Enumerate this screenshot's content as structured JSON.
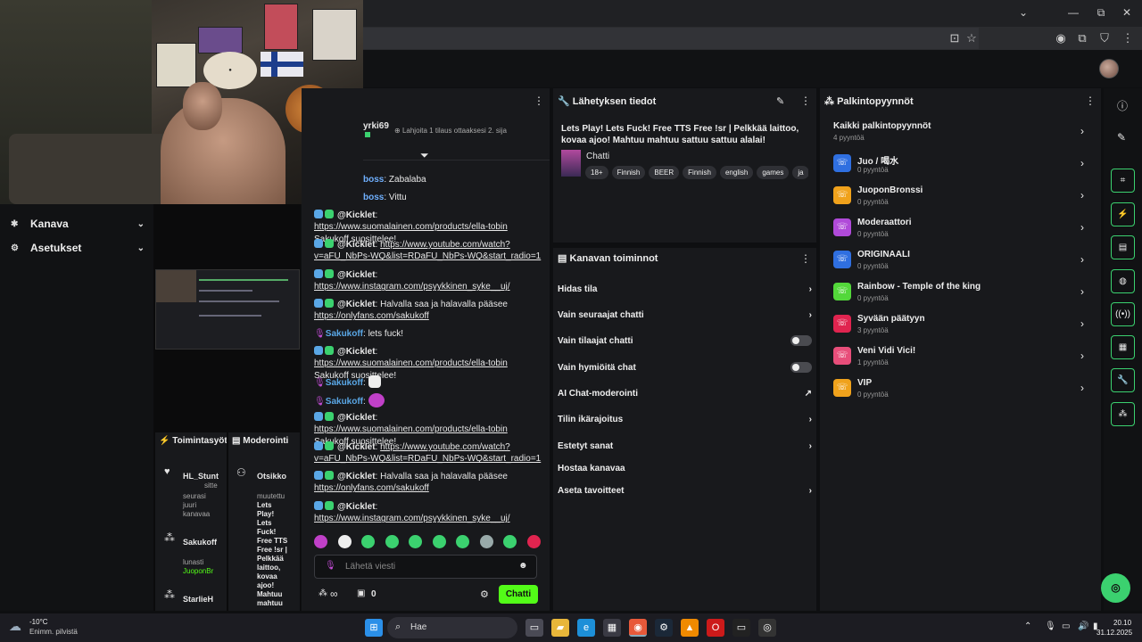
{
  "browser": {
    "window_controls": [
      "⌄",
      "—",
      "⧉",
      "✕"
    ]
  },
  "left_nav": {
    "items": [
      {
        "label": "Kanava"
      },
      {
        "label": "Asetukset"
      }
    ]
  },
  "activity_panel": {
    "title": "Toimintasyöt",
    "entries": [
      {
        "user": "HL_Stunt",
        "line1": "sitte",
        "line2": "seurasi",
        "line3": "juuri",
        "line4": "kanavaa"
      },
      {
        "user": "Sakukoff",
        "line1": "lunasti",
        "reward": "JuoponBr"
      },
      {
        "user": "StarlieH"
      }
    ]
  },
  "mod_panel": {
    "title": "Moderointi",
    "entry_title": "Otsikko",
    "entry_text": [
      "muutettu",
      "Lets",
      "Play!",
      "Lets",
      "Fuck!",
      "Free TTS",
      "Free !sr |",
      "Pelkkää",
      "laittoo,",
      "kovaa",
      "ajoo!",
      "Mahtuu",
      "mahtuu"
    ]
  },
  "chat": {
    "top_user": "yrki69",
    "sub_prompt": "Lahjoita 1 tilaus ottaaksesi 2. sija",
    "messages": [
      {
        "user": "boss",
        "text": "Zabalaba",
        "kind": "plain"
      },
      {
        "user": "boss",
        "text": "Vittu",
        "kind": "plain"
      },
      {
        "user": "@Kicklet",
        "link": "https://www.suomalainen.com/products/ella-tobin",
        "text": " Sakukoff suosittelee!",
        "kind": "bot"
      },
      {
        "user": "@Kicklet",
        "link": "https://www.youtube.com/watch?v=aFU_NbPs-WQ&list=RDaFU_NbPs-WQ&start_radio=1",
        "text": "",
        "kind": "bot"
      },
      {
        "user": "@Kicklet",
        "link": "https://www.instagram.com/psyykkinen_syke__uj/",
        "text": "",
        "kind": "bot"
      },
      {
        "user": "@Kicklet",
        "text": "Halvalla saa ja halavalla pääsee ",
        "link": "https://onlyfans.com/sakukoff",
        "kind": "bot-text"
      },
      {
        "user": "Sakukoff",
        "text": "lets fuck!",
        "kind": "owner"
      },
      {
        "user": "@Kicklet",
        "link": "https://www.suomalainen.com/products/ella-tobin",
        "text": " Sakukoff suosittelee!",
        "kind": "bot"
      },
      {
        "user": "Sakukoff",
        "text": "",
        "kind": "owner-emote"
      },
      {
        "user": "Sakukoff",
        "text": "",
        "kind": "owner-emote"
      },
      {
        "user": "@Kicklet",
        "link": "https://www.suomalainen.com/products/ella-tobin",
        "text": " Sakukoff suosittelee!",
        "kind": "bot"
      },
      {
        "user": "@Kicklet",
        "link": "https://www.youtube.com/watch?v=aFU_NbPs-WQ&list=RDaFU_NbPs-WQ&start_radio=1",
        "text": "",
        "kind": "bot"
      },
      {
        "user": "@Kicklet",
        "text": "Halvalla saa ja halavalla pääsee ",
        "link": "https://onlyfans.com/sakukoff",
        "kind": "bot-text"
      },
      {
        "user": "@Kicklet",
        "link": "https://www.instagram.com/psyykkinen_syke__uj/",
        "text": "",
        "kind": "bot"
      }
    ],
    "input_placeholder": "Lähetä viesti",
    "infinity": "∞",
    "gift_count": "0",
    "send_label": "Chatti"
  },
  "stream_info": {
    "title": "Lähetyksen tiedot",
    "stream_title": "Lets Play! Lets Fuck! Free TTS Free !sr | Pelkkää laittoo, kovaa ajoo! Mahtuu mahtuu sattuu sattuu alalai!",
    "category": "Chatti",
    "tags": [
      "18+",
      "Finnish",
      "BEER",
      "Finnish",
      "english",
      "games",
      "ja"
    ]
  },
  "channel_actions": {
    "title": "Kanavan toiminnot",
    "rows": [
      {
        "label": "Hidas tila",
        "control": "chevron"
      },
      {
        "label": "Vain seuraajat chatti",
        "control": "chevron"
      },
      {
        "label": "Vain tilaajat chatti",
        "control": "toggle"
      },
      {
        "label": "Vain hymiöitä chat",
        "control": "toggle"
      },
      {
        "label": "AI Chat-moderointi",
        "control": "external"
      },
      {
        "label": "Tilin ikärajoitus",
        "control": "chevron"
      },
      {
        "label": "Estetyt sanat",
        "control": "chevron"
      },
      {
        "label": "Hostaa kanavaa",
        "control": "none"
      },
      {
        "label": "Aseta tavoitteet",
        "control": "chevron"
      }
    ]
  },
  "rewards": {
    "title": "Palkintopyynnöt",
    "all_label": "Kaikki palkintopyynnöt",
    "all_count": "4 pyyntöä",
    "items": [
      {
        "name": "Juo / 喝水",
        "count": "0 pyyntöä",
        "color": "#2f6fe0"
      },
      {
        "name": "JuoponBronssi",
        "count": "0 pyyntöä",
        "color": "#f0a21c"
      },
      {
        "name": "Moderaattori",
        "count": "0 pyyntöä",
        "color": "#b04ad9"
      },
      {
        "name": "ORIGINAALI",
        "count": "0 pyyntöä",
        "color": "#2f6fe0"
      },
      {
        "name": "Rainbow - Temple of the king",
        "count": "0 pyyntöä",
        "color": "#53d83a"
      },
      {
        "name": "Syvään päätyyn",
        "count": "3 pyyntöä",
        "color": "#e0244f"
      },
      {
        "name": "Veni Vidi Vici!",
        "count": "1 pyyntöä",
        "color": "#e84e7a"
      },
      {
        "name": "VIP",
        "count": "0 pyyntöä",
        "color": "#f0a21c"
      }
    ]
  },
  "taskbar": {
    "weather_temp": "-10°C",
    "weather_desc": "Enimm. pilvistä",
    "search_label": "Hae",
    "time": "20.10",
    "date": "31.12.2025"
  },
  "colors": {
    "accent": "#53fc18",
    "panel": "#18191c"
  }
}
